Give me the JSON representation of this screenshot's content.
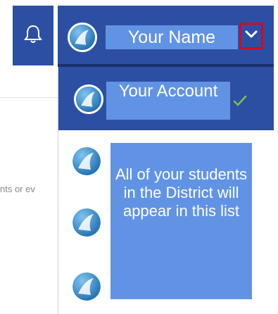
{
  "header": {
    "user_name": "Your Name"
  },
  "search": {
    "snippet": "nts or ev"
  },
  "dropdown": {
    "current_account_label": "Your Account",
    "info_text": "All of your students in the District will appear in this list",
    "student_count_shown": 3
  },
  "icons": {
    "notification": "bell-icon",
    "toggle": "chevron-down-icon",
    "selected": "checkmark-icon",
    "avatar": "avatar-icon"
  },
  "colors": {
    "header_bg": "#2d4fa3",
    "label_bg": "#6193e4",
    "toggle_highlight": "#e0001b",
    "check": "#7ec14a"
  }
}
